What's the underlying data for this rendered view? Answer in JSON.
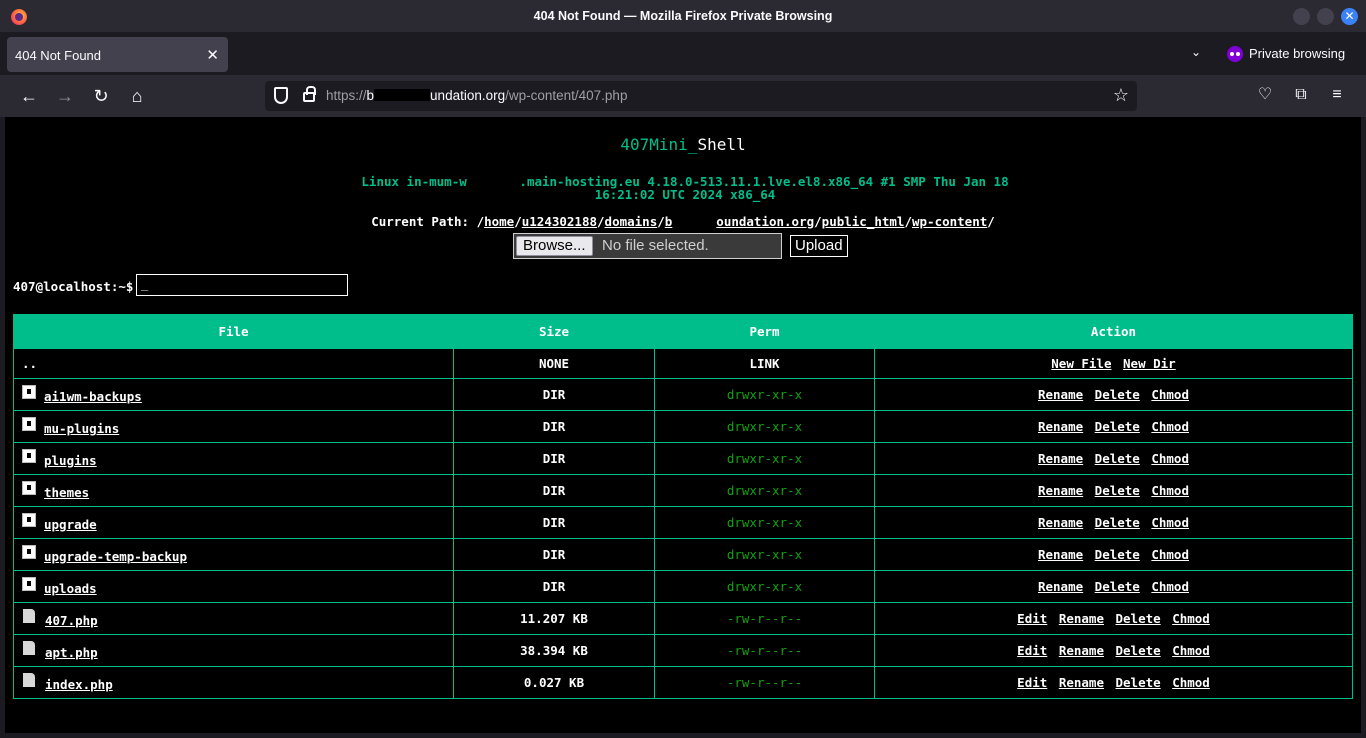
{
  "window": {
    "title": "404 Not Found — Mozilla Firefox Private Browsing"
  },
  "tab": {
    "title": "404 Not Found",
    "private_label": "Private browsing"
  },
  "urlbar": {
    "scheme": "https://",
    "host_start": "b",
    "host_end": "undation.org",
    "path": "/wp-content/407.php"
  },
  "page": {
    "title_part1": "407Mini_",
    "title_part2": "Shell",
    "uname_line1": "Linux in-mum-w       .main-hosting.eu 4.18.0-513.11.1.lve.el8.x86_64 #1 SMP Thu Jan 18",
    "uname_line2": "16:21:02 UTC 2024 x86_64",
    "path_label": "Current Path:",
    "path_segments": [
      "home",
      "u124302188",
      "domains",
      "b",
      "oundation.org",
      "public_html",
      "wp-content"
    ],
    "browse_label": "Browse...",
    "no_file_label": "No file selected.",
    "upload_label": "Upload",
    "prompt": "407@localhost:~$",
    "cmd_value": "_"
  },
  "table": {
    "headers": [
      "File",
      "Size",
      "Perm",
      "Action"
    ],
    "parent": {
      "name": "..",
      "size": "NONE",
      "perm": "LINK",
      "actions": [
        "New File",
        "New Dir"
      ]
    },
    "rows": [
      {
        "name": "ai1wm-backups",
        "type": "dir",
        "size": "DIR",
        "perm": "drwxr-xr-x"
      },
      {
        "name": "mu-plugins",
        "type": "dir",
        "size": "DIR",
        "perm": "drwxr-xr-x"
      },
      {
        "name": "plugins",
        "type": "dir",
        "size": "DIR",
        "perm": "drwxr-xr-x"
      },
      {
        "name": "themes",
        "type": "dir",
        "size": "DIR",
        "perm": "drwxr-xr-x"
      },
      {
        "name": "upgrade",
        "type": "dir",
        "size": "DIR",
        "perm": "drwxr-xr-x"
      },
      {
        "name": "upgrade-temp-backup",
        "type": "dir",
        "size": "DIR",
        "perm": "drwxr-xr-x"
      },
      {
        "name": "uploads",
        "type": "dir",
        "size": "DIR",
        "perm": "drwxr-xr-x"
      },
      {
        "name": "407.php",
        "type": "file",
        "size": "11.207 KB",
        "perm": "-rw-r--r--"
      },
      {
        "name": "apt.php",
        "type": "file",
        "size": "38.394 KB",
        "perm": "-rw-r--r--"
      },
      {
        "name": "index.php",
        "type": "file",
        "size": "0.027 KB",
        "perm": "-rw-r--r--"
      }
    ],
    "dir_actions": [
      "Rename",
      "Delete",
      "Chmod"
    ],
    "file_actions": [
      "Edit",
      "Rename",
      "Delete",
      "Chmod"
    ]
  },
  "colors": {
    "accent": "#00bd8c",
    "perm_green": "#13a010",
    "background": "#000000"
  }
}
